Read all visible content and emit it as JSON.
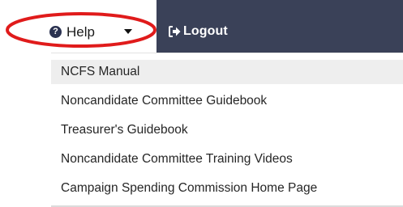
{
  "nav": {
    "help_label": "Help",
    "help_icon": "question-circle-icon",
    "logout_label": "Logout",
    "logout_icon": "sign-out-icon",
    "bar_color": "#3a4158",
    "highlight_color": "#e01b1b"
  },
  "help_menu": {
    "items": [
      {
        "label": "NCFS Manual"
      },
      {
        "label": "Noncandidate Committee Guidebook"
      },
      {
        "label": "Treasurer's Guidebook"
      },
      {
        "label": "Noncandidate Committee Training Videos"
      },
      {
        "label": "Campaign Spending Commission Home Page"
      }
    ]
  }
}
